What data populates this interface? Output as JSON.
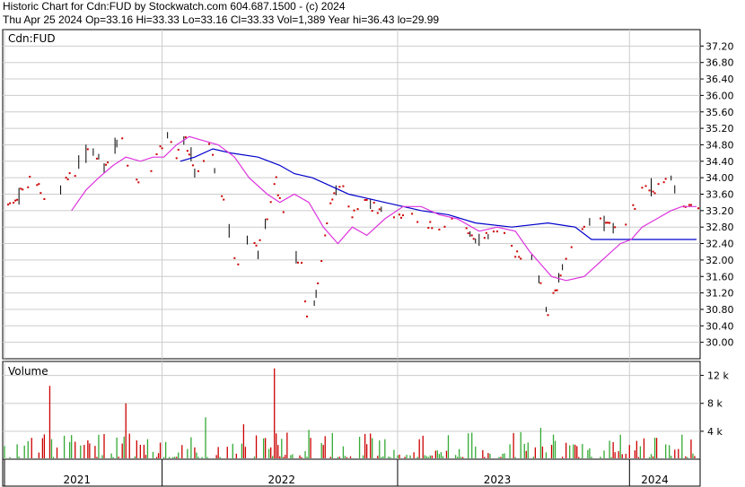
{
  "header": {
    "line1": "Historic Chart for Cdn:FUD by Stockwatch.com 604.687.1500 - (c) 2024",
    "line2": "Thu Apr 25 2024   Op=33.16   Hi=33.33   Lo=33.16   Cl=33.33   Vol=1,389   Year hi=36.43   lo=29.99"
  },
  "colors": {
    "price_dot": "#cc0000",
    "price_bar": "#000000",
    "ma_long": "#0000cc",
    "ma_short": "#dd33dd",
    "volume_up": "#33aa33",
    "volume_down": "#cc0000",
    "grid": "#cccccc"
  },
  "chart_data": [
    {
      "type": "scatter",
      "title": "Cdn:FUD",
      "y_ticks": [
        "37.20",
        "36.80",
        "36.40",
        "36.00",
        "35.60",
        "35.20",
        "34.80",
        "34.40",
        "34.00",
        "33.60",
        "33.20",
        "32.80",
        "32.40",
        "32.00",
        "31.60",
        "31.20",
        "30.80",
        "30.40",
        "30.00"
      ],
      "ylim": [
        29.6,
        37.6
      ],
      "grid": true,
      "x_labels": [
        "2021",
        "2022",
        "2023",
        "2024"
      ],
      "x_label_index": [
        40,
        153,
        272,
        359
      ],
      "year_dividers_index": [
        0,
        87,
        217,
        345
      ],
      "n_bars": 384,
      "price_anchors": {
        "index": [
          0,
          8,
          16,
          24,
          32,
          40,
          48,
          56,
          64,
          68,
          72,
          80,
          90,
          94,
          100,
          106,
          113,
          120,
          124,
          126,
          128,
          134,
          140,
          144,
          150,
          158,
          164,
          168,
          174,
          180,
          186,
          192,
          198,
          200,
          210,
          222,
          232,
          240,
          250,
          262,
          274,
          282,
          292,
          300,
          306,
          312,
          318,
          320,
          324,
          330,
          336,
          342,
          348,
          354,
          360,
          368,
          374,
          382
        ],
        "value": [
          33.3,
          33.6,
          34.0,
          33.4,
          33.8,
          34.2,
          34.7,
          34.2,
          35.2,
          34.4,
          33.8,
          34.2,
          35.0,
          34.5,
          34.9,
          34.0,
          34.8,
          33.6,
          32.7,
          32.4,
          31.8,
          32.6,
          32.2,
          32.9,
          33.9,
          32.2,
          31.9,
          30.3,
          31.7,
          33.4,
          33.9,
          33.0,
          33.6,
          33.4,
          33.1,
          33.1,
          32.9,
          32.8,
          33.0,
          32.5,
          32.7,
          32.2,
          32.0,
          30.7,
          31.5,
          32.2,
          32.6,
          32.8,
          33.1,
          32.9,
          32.8,
          32.9,
          33.3,
          33.8,
          33.7,
          34.0,
          33.3,
          33.33
        ]
      },
      "series": [
        {
          "type": "line",
          "index": [
            97,
            105,
            115,
            125,
            140,
            152,
            160,
            170,
            180,
            190,
            200,
            210,
            230,
            245,
            260,
            280,
            300,
            315,
            324,
            334,
            345,
            360,
            370,
            382
          ],
          "values": [
            34.4,
            34.5,
            34.7,
            34.6,
            34.5,
            34.3,
            34.1,
            34.0,
            33.8,
            33.6,
            33.5,
            33.4,
            33.2,
            33.1,
            32.9,
            32.8,
            32.9,
            32.8,
            32.5,
            32.5,
            32.5,
            32.5,
            32.5,
            32.5
          ]
        },
        {
          "type": "line",
          "index": [
            37,
            45,
            52,
            60,
            67,
            75,
            82,
            88,
            95,
            102,
            110,
            118,
            127,
            135,
            145,
            152,
            160,
            168,
            176,
            184,
            192,
            200,
            210,
            220,
            230,
            240,
            250,
            262,
            272,
            282,
            290,
            296,
            302,
            310,
            320,
            330,
            340,
            346,
            352,
            360,
            368,
            374,
            382
          ],
          "values": [
            33.2,
            33.7,
            34.0,
            34.3,
            34.5,
            34.4,
            34.5,
            34.5,
            34.8,
            35.0,
            34.9,
            34.8,
            34.5,
            34.0,
            33.6,
            33.4,
            33.6,
            33.4,
            32.8,
            32.4,
            32.8,
            32.6,
            33.0,
            33.3,
            33.3,
            33.1,
            33.0,
            32.7,
            32.8,
            32.7,
            32.2,
            31.9,
            31.6,
            31.5,
            31.6,
            32.0,
            32.4,
            32.5,
            32.8,
            33.0,
            33.2,
            33.3,
            33.3
          ]
        }
      ]
    },
    {
      "type": "bar",
      "title": "Volume",
      "y_ticks": [
        "12 k",
        "8 k",
        "4 k"
      ],
      "ylim": [
        0,
        14
      ]
    }
  ]
}
